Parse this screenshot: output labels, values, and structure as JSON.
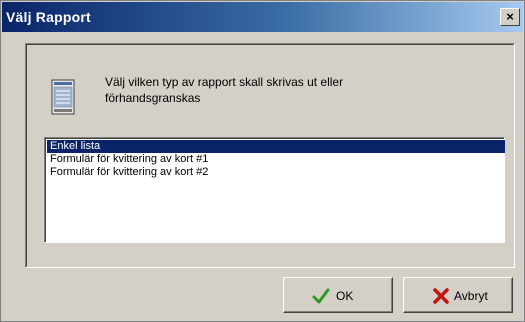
{
  "window": {
    "title": "Välj Rapport",
    "close_glyph": "×"
  },
  "description": "Välj vilken typ av rapport skall skrivas ut eller förhandsgranskas",
  "report_types": [
    {
      "label": "Enkel lista",
      "selected": true
    },
    {
      "label": "Formulär för kvittering av kort #1",
      "selected": false
    },
    {
      "label": "Formulär för kvittering av kort #2",
      "selected": false
    }
  ],
  "buttons": {
    "ok": {
      "label": "OK",
      "icon": "checkmark-icon",
      "color": "#2e9a1c"
    },
    "cancel": {
      "label": "Avbryt",
      "icon": "cross-icon",
      "color": "#c8120e"
    }
  },
  "colors": {
    "title_bar_start": "#0a246a",
    "title_bar_end": "#a6caf0",
    "selection": "#0a246a",
    "dialog_face": "#d4d0c8"
  }
}
